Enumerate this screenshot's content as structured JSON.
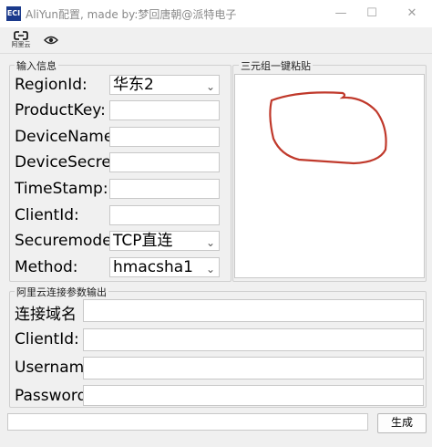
{
  "window": {
    "title": "AliYun配置, made by:梦回唐朝@派特电子",
    "icon_text": "ECI",
    "minimize": "—",
    "maximize": "☐",
    "close": "✕"
  },
  "toolbar": {
    "aliyun_label": "阿里云",
    "aliyun_icon": "cloud-link-icon",
    "view_icon": "eye-icon"
  },
  "input_group": {
    "title": "输入信息",
    "fields": {
      "region": {
        "label": "RegionId:",
        "value": "华东2"
      },
      "product_key": {
        "label": "ProductKey:",
        "value": ""
      },
      "device_name": {
        "label": "DeviceName:",
        "value": ""
      },
      "device_secret": {
        "label": "DeviceSecret:",
        "value": ""
      },
      "timestamp": {
        "label": "TimeStamp:",
        "value": ""
      },
      "client_id": {
        "label": "ClientId:",
        "value": ""
      },
      "secure_mode": {
        "label": "Securemode:",
        "value": "TCP直连"
      },
      "method": {
        "label": "Method:",
        "value": "hmacsha1"
      }
    }
  },
  "paste_group": {
    "title": "三元组一键粘贴",
    "annotation_color": "#c0392b"
  },
  "output_group": {
    "title": "阿里云连接参数输出",
    "fields": {
      "domain": {
        "label": "连接域名",
        "value": ""
      },
      "client_id": {
        "label": "ClientId:",
        "value": ""
      },
      "username": {
        "label": "Username:",
        "value": ""
      },
      "password": {
        "label": "Password:",
        "value": ""
      }
    }
  },
  "bottom": {
    "status_value": "",
    "generate_label": "生成"
  }
}
